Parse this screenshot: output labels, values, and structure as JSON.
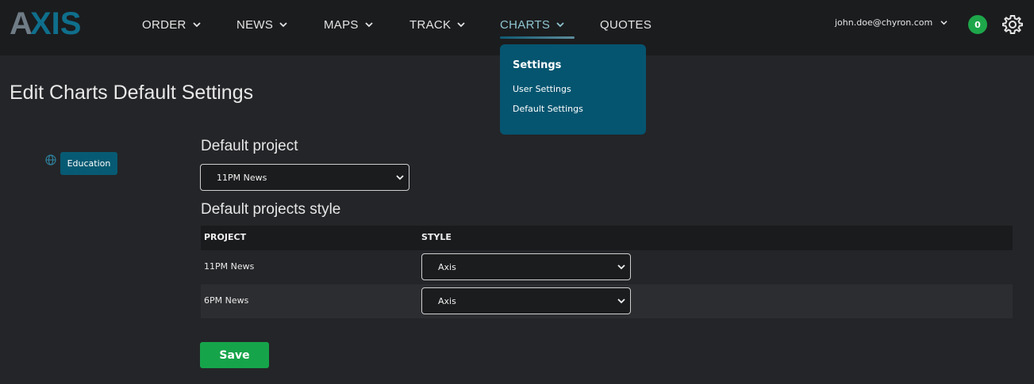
{
  "brand": {
    "logo_text": "AXIS",
    "colors": {
      "logo_a": "#6f7c86",
      "logo_xis": "#0f6f8c"
    }
  },
  "nav": {
    "items": [
      {
        "label": "ORDER",
        "has_menu": true
      },
      {
        "label": "NEWS",
        "has_menu": true
      },
      {
        "label": "MAPS",
        "has_menu": true
      },
      {
        "label": "TRACK",
        "has_menu": true
      },
      {
        "label": "CHARTS",
        "has_menu": true,
        "active": true
      },
      {
        "label": "QUOTES",
        "has_menu": false
      }
    ]
  },
  "user": {
    "email": "john.doe@chyron.com",
    "notification_count": "0",
    "settings_icon": "gear-icon"
  },
  "charts_menu": {
    "title": "Settings",
    "items": [
      "User Settings",
      "Default Settings"
    ]
  },
  "page": {
    "title": "Edit Charts Default Settings"
  },
  "sidebar": {
    "icon": "globe-icon",
    "group_label": "Education"
  },
  "default_project": {
    "label": "Default project",
    "selected": "11PM News"
  },
  "projects_style": {
    "label": "Default projects style",
    "columns": [
      "PROJECT",
      "STYLE"
    ],
    "rows": [
      {
        "project": "11PM News",
        "style": "Axis"
      },
      {
        "project": "6PM News",
        "style": "Axis"
      }
    ]
  },
  "actions": {
    "save_label": "Save"
  },
  "colors": {
    "accent": "#055570",
    "save": "#16a44a",
    "badge": "#1ea64a"
  }
}
